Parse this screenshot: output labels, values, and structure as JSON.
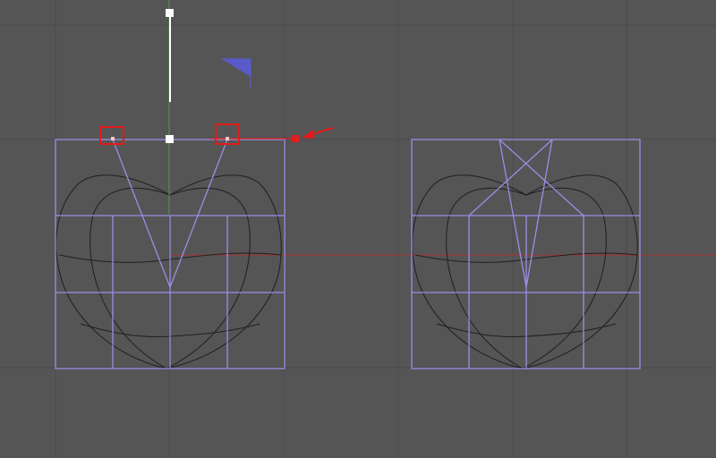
{
  "viewport": {
    "view": "front-orthographic",
    "grid_color": "#4a4a4a",
    "background_color": "#555555",
    "cage_color": "#9a8ee6",
    "mesh_color": "#1f1f1f",
    "x_axis_color": "#b83030",
    "y_axis_color": "#3aa83a",
    "selection_color": "#e01a1a",
    "gizmo_handle_color": "#ffffff",
    "view_cube_color": "#5a5ac8"
  },
  "icons": {
    "annotation_arrow": "red-arrow-icon",
    "view_indicator": "view-cube-corner-icon"
  }
}
